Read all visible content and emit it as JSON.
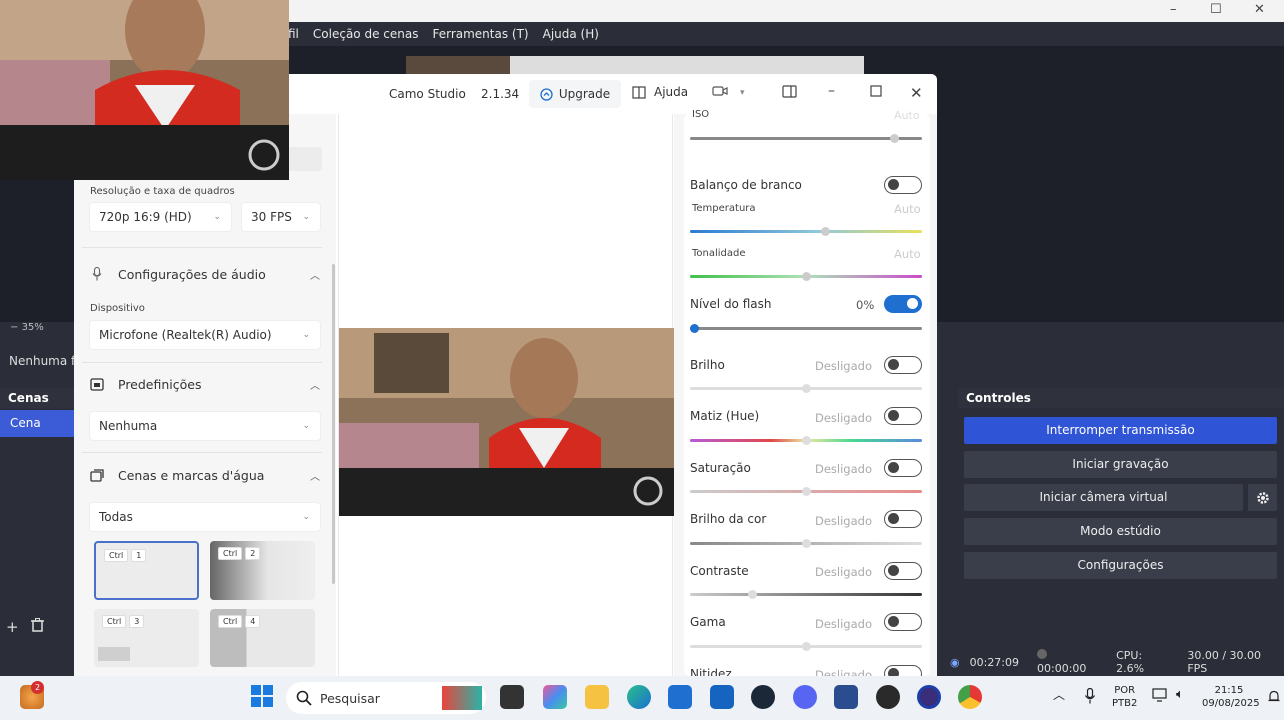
{
  "obs": {
    "menu": [
      "fil",
      "Coleção de cenas",
      "Ferramentas (T)",
      "Ajuda (H)"
    ],
    "zoom": "35%",
    "source_text": "Nenhuma f",
    "scenes_header": "Cenas",
    "scene_item": "Cena",
    "controls_header": "Controles",
    "controls": {
      "stop_stream": "Interromper transmissão",
      "start_recording": "Iniciar gravação",
      "start_virtual_cam": "Iniciar câmera virtual",
      "studio_mode": "Modo estúdio",
      "settings": "Configurações"
    },
    "status": {
      "stream_time": "00:27:09",
      "rec_time": "00:00:00",
      "cpu": "CPU: 2.6%",
      "fps": "30.00 / 30.00 FPS"
    },
    "window_controls": {
      "minimize": "–",
      "maximize": "☐",
      "close": "✕"
    }
  },
  "camo": {
    "title": "Camo Studio",
    "version": "2.1.34",
    "upgrade": "Upgrade",
    "help": "Ajuda",
    "left": {
      "resolution_label": "Resolução e taxa de quadros",
      "resolution": "720p 16:9 (HD)",
      "fps": "30 FPS",
      "audio_section": "Configurações de áudio",
      "device_label": "Dispositivo",
      "device": "Microfone (Realtek(R) Audio)",
      "presets_section": "Predefinições",
      "preset": "Nenhuma",
      "scenes_section": "Cenas e marcas d'água",
      "scenes_filter": "Todas",
      "tiles": [
        {
          "key": "Ctrl",
          "num": "1"
        },
        {
          "key": "Ctrl",
          "num": "2"
        },
        {
          "key": "Ctrl",
          "num": "3"
        },
        {
          "key": "Ctrl",
          "num": "4"
        }
      ]
    },
    "right": {
      "iso_label": "ISO",
      "iso_state": "Auto",
      "white_balance": "Balanço de branco",
      "temperature": "Temperatura",
      "temperature_state": "Auto",
      "tint": "Tonalidade",
      "tint_state": "Auto",
      "flash": "Nível do flash",
      "flash_value": "0%",
      "brightness": "Brilho",
      "hue": "Matiz (Hue)",
      "saturation": "Saturação",
      "color_brightness": "Brilho da cor",
      "contrast": "Contraste",
      "gamma": "Gama",
      "sharpness": "Nitidez",
      "off": "Desligado"
    }
  },
  "taskbar": {
    "search_placeholder": "Pesquisar",
    "badge": "2",
    "lang": "POR",
    "layout": "PTB2",
    "time": "21:15",
    "date": "09/08/2025"
  }
}
